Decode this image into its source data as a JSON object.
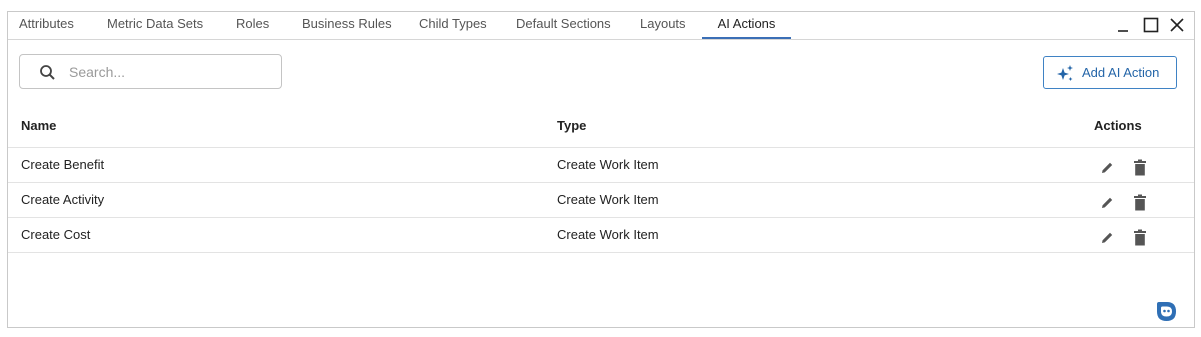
{
  "tabs": [
    {
      "label": "Attributes"
    },
    {
      "label": "Metric Data Sets"
    },
    {
      "label": "Roles"
    },
    {
      "label": "Business Rules"
    },
    {
      "label": "Child Types"
    },
    {
      "label": "Default Sections"
    },
    {
      "label": "Layouts"
    },
    {
      "label": "AI Actions",
      "active": true
    }
  ],
  "window_controls": {
    "minimize": "_",
    "maximize": "☐",
    "close": "✕"
  },
  "search": {
    "placeholder": "Search...",
    "value": "",
    "icon": "search-icon"
  },
  "toolbar": {
    "add_label": "Add AI Action",
    "add_icon": "sparkle-icon"
  },
  "table": {
    "headers": {
      "name": "Name",
      "type": "Type",
      "actions": "Actions"
    },
    "rows": [
      {
        "name": "Create Benefit",
        "type": "Create Work Item"
      },
      {
        "name": "Create Activity",
        "type": "Create Work Item"
      },
      {
        "name": "Create Cost",
        "type": "Create Work Item"
      }
    ],
    "row_actions": [
      "pencil-icon",
      "trash-icon"
    ]
  },
  "colors": {
    "accent": "#2465a8",
    "active_tab_underline": "#3b6fb6",
    "icon_gray": "#555555",
    "bot": "#2f6fb5"
  },
  "assistant": {
    "icon": "chatbot-icon"
  }
}
